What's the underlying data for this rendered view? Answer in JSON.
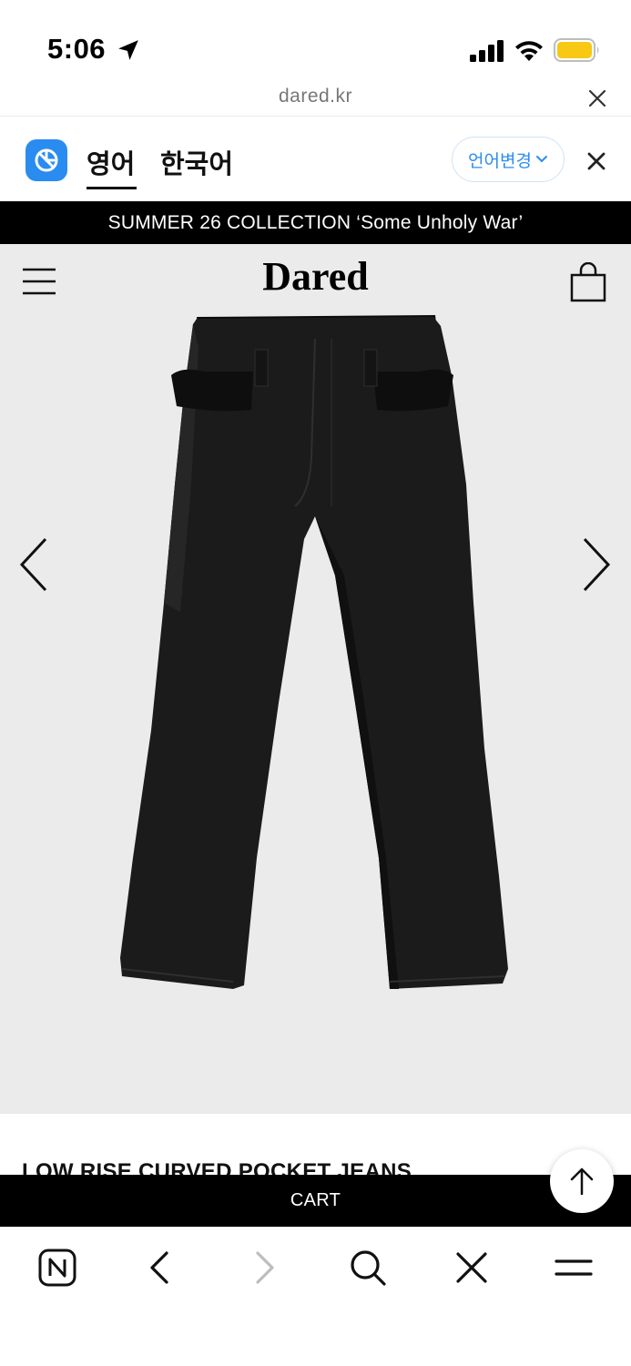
{
  "status_bar": {
    "time": "5:06"
  },
  "url_bar": {
    "domain": "dared.kr"
  },
  "translate_bar": {
    "tab_english": "영어",
    "tab_korean": "한국어",
    "change_language": "언어변경",
    "accent_color": "#2a8cf0"
  },
  "announcement": {
    "text": "SUMMER 26 COLLECTION ‘Some Unholy War’"
  },
  "header": {
    "brand": "Dared"
  },
  "product": {
    "title": "LOW RISE CURVED POCKET JEANS"
  },
  "cart_bar": {
    "label": "CART"
  },
  "toolbar": {
    "icons": [
      "naver-n-icon",
      "back-icon",
      "forward-icon",
      "search-icon",
      "close-icon",
      "menu-icon"
    ]
  }
}
